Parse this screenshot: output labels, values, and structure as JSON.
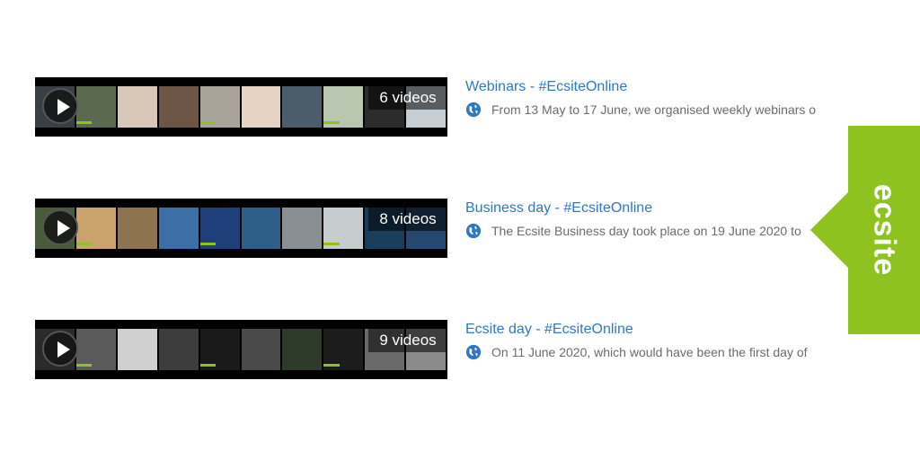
{
  "playlists": [
    {
      "count_label": "6 videos",
      "title": "Webinars - #EcsiteOnline",
      "description": "From 13 May to 17 June, we organised weekly webinars o",
      "frame_colors": [
        "#3a3f45",
        "#5b6a4f",
        "#d9c7b8",
        "#6e5646",
        "#a9a39a",
        "#e6d3c4",
        "#4c5c6a",
        "#b9c7b0",
        "#2c2c2c",
        "#c7cfd4"
      ]
    },
    {
      "count_label": "8 videos",
      "title": "Business day - #EcsiteOnline",
      "description": "The Ecsite Business day took place on 19 June 2020 to",
      "frame_colors": [
        "#4a5b3a",
        "#c9a36b",
        "#8d7350",
        "#3b6fa6",
        "#1f3f7a",
        "#2d5f8a",
        "#8a8f94",
        "#c7cccf",
        "#1a3d5c",
        "#24486e"
      ]
    },
    {
      "count_label": "9 videos",
      "title": "Ecsite day - #EcsiteOnline",
      "description": "On 11 June 2020, which would have been the first day of",
      "frame_colors": [
        "#2a2a2a",
        "#5a5a5a",
        "#d0d0d0",
        "#3d3d3d",
        "#1a1a1a",
        "#4a4a4a",
        "#2e3a2a",
        "#1c1c1c",
        "#6a6a6a",
        "#8a8a8a"
      ]
    }
  ],
  "brand": {
    "label": "ecsite",
    "color": "#8dc21f"
  },
  "icons": {
    "play": "play-icon",
    "globe": "globe-icon"
  }
}
